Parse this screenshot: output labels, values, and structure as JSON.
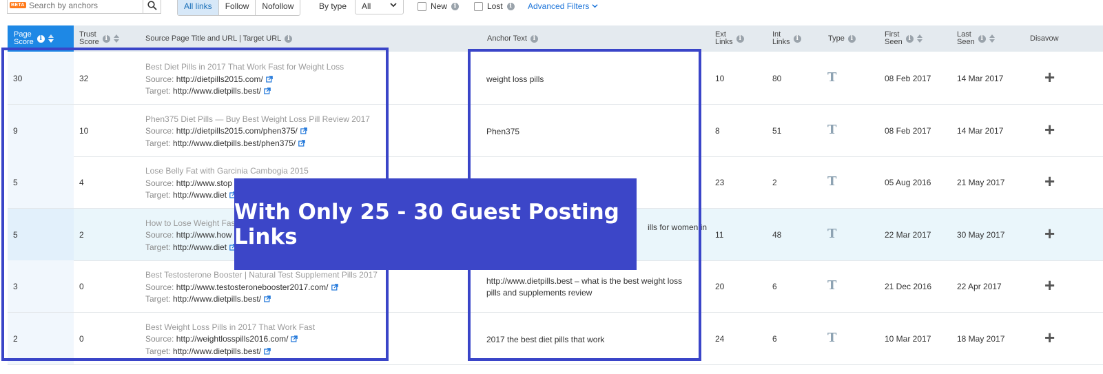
{
  "toolbar": {
    "beta_badge": "BETA",
    "search_placeholder": "Search by anchors",
    "filters": [
      "All links",
      "Follow",
      "Nofollow"
    ],
    "by_type_label": "By type",
    "type_select_value": "All",
    "new_label": "New",
    "lost_label": "Lost",
    "advanced_filters": "Advanced Filters"
  },
  "columns": {
    "page_score": [
      "Page",
      "Score"
    ],
    "trust_score": [
      "Trust",
      "Score"
    ],
    "source": "Source Page Title and URL | Target URL",
    "anchor": "Anchor Text",
    "ext_links": [
      "Ext",
      "Links"
    ],
    "int_links": [
      "Int",
      "Links"
    ],
    "type": "Type",
    "first_seen": [
      "First",
      "Seen"
    ],
    "last_seen": [
      "Last",
      "Seen"
    ],
    "disavow": "Disavow"
  },
  "labels": {
    "source": "Source:",
    "target": "Target:"
  },
  "rows": [
    {
      "page_score": "30",
      "trust_score": "32",
      "title": "Best Diet Pills in 2017 That Work Fast for Weight Loss",
      "source_url": "http://dietpills2015.com/",
      "target_url": "http://www.dietpills.best/",
      "anchor": "weight loss pills",
      "ext_links": "10",
      "int_links": "80",
      "type": "T",
      "first_seen": "08 Feb 2017",
      "last_seen": "14 Mar 2017"
    },
    {
      "page_score": "9",
      "trust_score": "10",
      "title": "Phen375 Diet Pills — Buy Best Weight Loss Pill Review 2017",
      "source_url": "http://dietpills2015.com/phen375/",
      "target_url": "http://www.dietpills.best/phen375/",
      "anchor": "Phen375",
      "ext_links": "8",
      "int_links": "51",
      "type": "T",
      "first_seen": "08 Feb 2017",
      "last_seen": "14 Mar 2017"
    },
    {
      "page_score": "5",
      "trust_score": "4",
      "title": "Lose Belly Fat with Garcinia Cambogia 2015",
      "source_url": "http://www.stop",
      "target_url": "http://www.diet",
      "anchor": "",
      "ext_links": "23",
      "int_links": "2",
      "type": "T",
      "first_seen": "05 Aug 2016",
      "last_seen": "21 May 2017"
    },
    {
      "page_score": "5",
      "trust_score": "2",
      "title": "How to Lose Weight Fast",
      "source_url": "http://www.how",
      "target_url": "http://www.diet",
      "anchor": "ills for women in",
      "ext_links": "11",
      "int_links": "48",
      "type": "T",
      "first_seen": "22 Mar 2017",
      "last_seen": "30 May 2017"
    },
    {
      "page_score": "3",
      "trust_score": "0",
      "title": "Best Testosterone Booster | Natural Test Supplement Pills 2017",
      "source_url": "http://www.testosteronebooster2017.com/",
      "target_url": "http://www.dietpills.best/",
      "anchor": "http://www.dietpills.best – what is the best weight loss pills and supplements review",
      "ext_links": "20",
      "int_links": "6",
      "type": "T",
      "first_seen": "21 Dec 2016",
      "last_seen": "22 Apr 2017"
    },
    {
      "page_score": "2",
      "trust_score": "0",
      "title": "Best Weight Loss Pills in 2017 That Work Fast",
      "source_url": "http://weightlosspills2016.com/",
      "target_url": "http://www.dietpills.best/",
      "anchor": "2017 the best diet pills that work",
      "ext_links": "24",
      "int_links": "6",
      "type": "T",
      "first_seen": "10 Mar 2017",
      "last_seen": "18 May 2017"
    }
  ],
  "overlay": {
    "banner_text": "With Only 25 - 30 Guest Posting Links"
  },
  "colors": {
    "accent": "#1e88e5",
    "frame": "#3a45c8",
    "banner": "#3c46c8"
  }
}
